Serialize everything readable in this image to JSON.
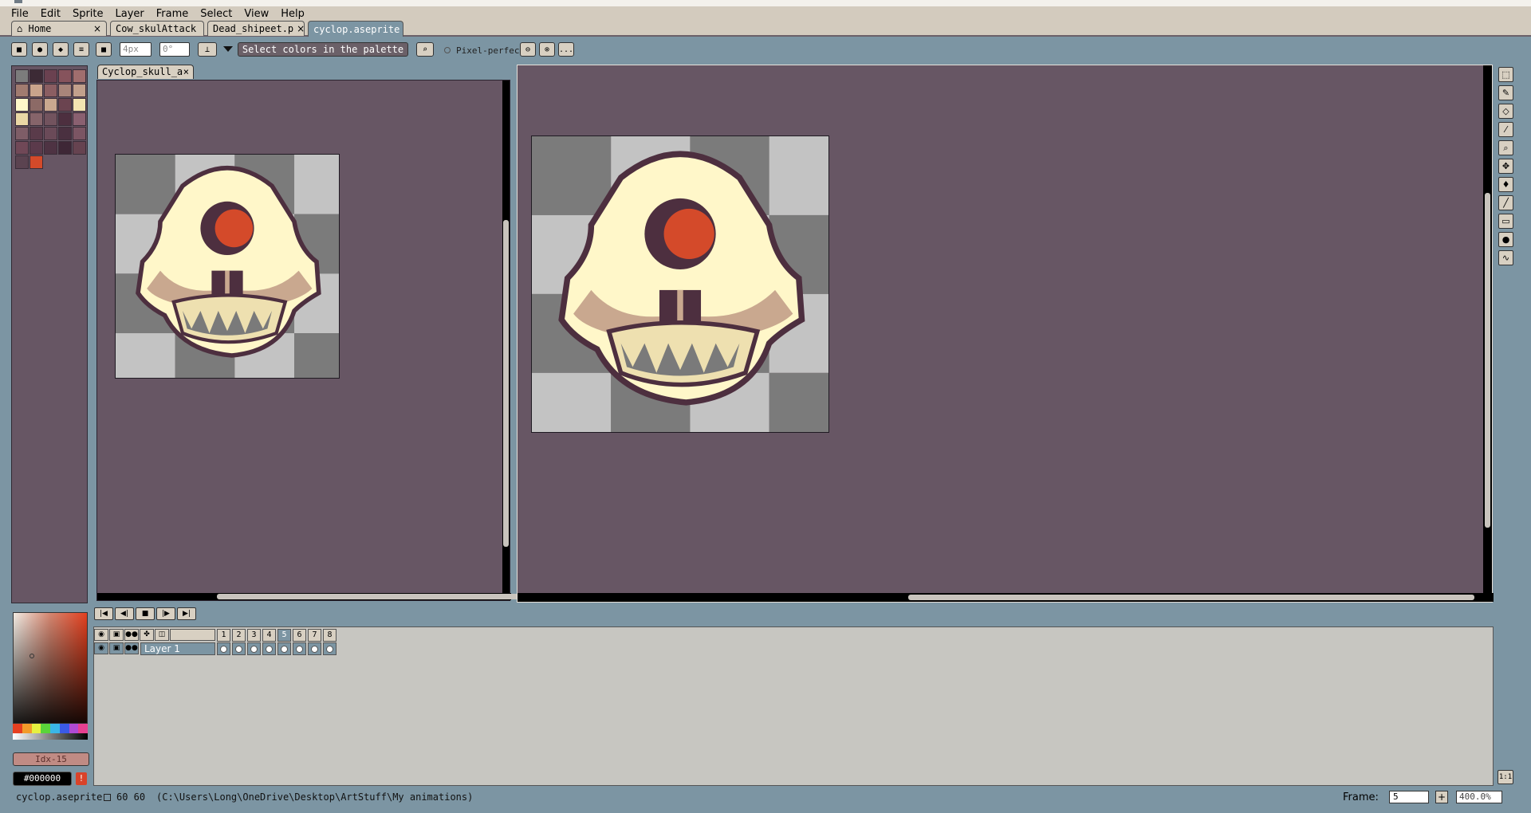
{
  "menu": [
    "File",
    "Edit",
    "Sprite",
    "Layer",
    "Frame",
    "Select",
    "View",
    "Help"
  ],
  "tabs": [
    {
      "label": "Home",
      "icon": "home-icon",
      "end": "×"
    },
    {
      "label": "Cow_skulAttack",
      "end": "•"
    },
    {
      "label": "Dead_shipeet.p",
      "end": "×"
    },
    {
      "label": "cyclop.aseprite",
      "end": "•",
      "active": true
    }
  ],
  "toolbar": {
    "size_value": "4px",
    "angle_value": "0°",
    "hint": "Select colors in the palette",
    "pixel_perfect_label": "Pixel-perfect",
    "more_label": "..."
  },
  "editor1": {
    "tab_label": "Cyclop_skull_a",
    "close": "×"
  },
  "palette_colors": [
    "#7c7c7c",
    "#3c2a35",
    "#6a4150",
    "#86535c",
    "#a06e6e",
    "#a17b70",
    "#c9a48c",
    "#8b5e62",
    "#a8857a",
    "#c2a08c",
    "#fff7c9",
    "#8c6a66",
    "#c9a88f",
    "#6b4450",
    "#f3e4b1",
    "#ead7a5",
    "#86646a",
    "#72535e",
    "#4d2f3f",
    "#8a6070",
    "#7e5d67",
    "#5a3b4a",
    "#6a4a58",
    "#4a3040",
    "#7b5563",
    "#704857",
    "#5b3a4b",
    "#4e3343",
    "#3e2736",
    "#664350",
    "#5b4350",
    "#d44a2a"
  ],
  "timeline": {
    "layer_name": "Layer 1",
    "frames": [
      "1",
      "2",
      "3",
      "4",
      "5",
      "6",
      "7",
      "8"
    ],
    "selected_frame": "5"
  },
  "color_picker": {
    "index_label": "Idx-15",
    "hex": "#000000",
    "hue_colors": [
      "#e64020",
      "#f29b2a",
      "#e6f040",
      "#5ad43a",
      "#3ab6e6",
      "#3a5ae6",
      "#b04ad4",
      "#e64090"
    ]
  },
  "status": {
    "file": "cyclop.aseprite",
    "size": "60 60",
    "path": "(C:\\Users\\Long\\OneDrive\\Desktop\\ArtStuff\\My animations)",
    "frame_label": "Frame:",
    "frame_value": "5",
    "add_frame": "+",
    "zoom": "400.0%"
  },
  "colors": {
    "canvas_bg": "#675664",
    "ui_blue": "#7c95a3",
    "bone": "#fff7c9",
    "bone_shade": "#c9a88f",
    "outline": "#4d2f3f",
    "eye": "#d44a2a"
  }
}
